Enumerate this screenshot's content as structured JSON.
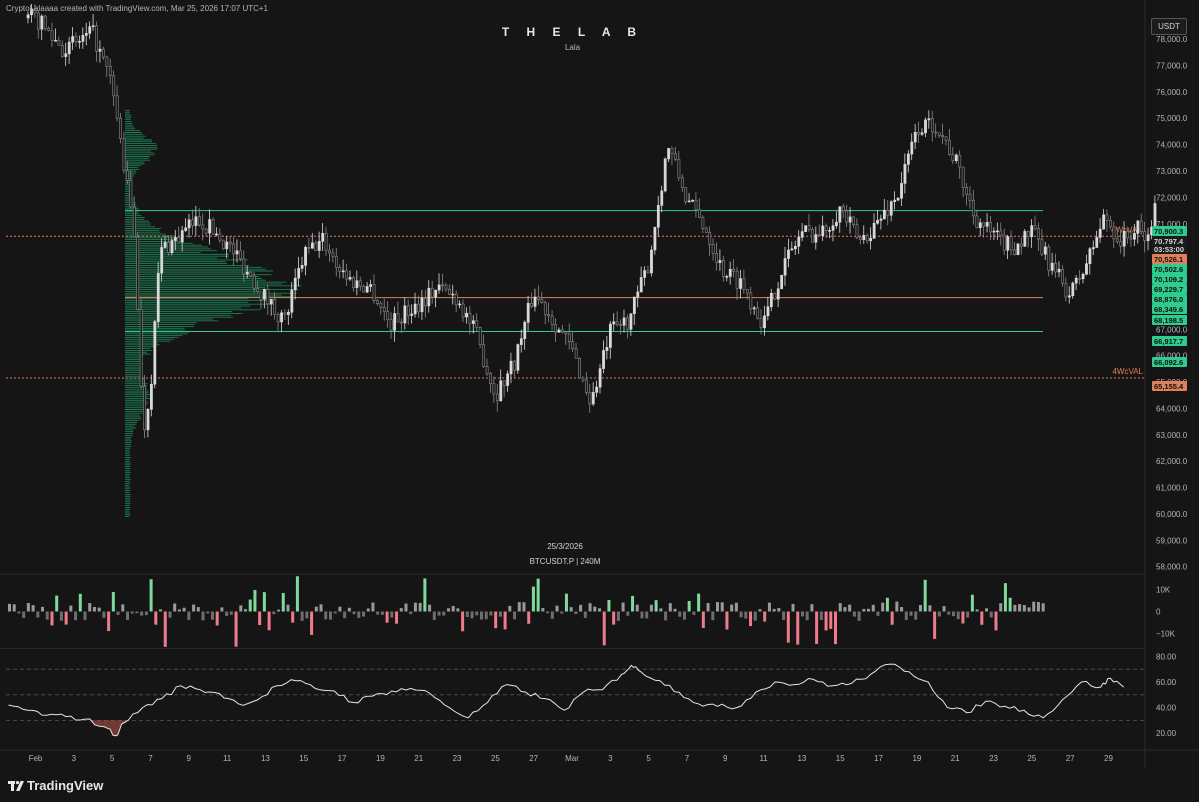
{
  "header": {
    "credit": "CryptoLalaaaa created with TradingView.com, Mar 25, 2026 17:07 UTC+1",
    "title": "T H E  L A B",
    "subtitle": "Lala",
    "currency_button": "USDT",
    "date_caption": "25/3/2026",
    "symbol_caption": "BTCUSDT.P | 240M",
    "brand": "TradingView"
  },
  "colors": {
    "background": "#151515",
    "green_level": "#2ecc8f",
    "orange_level": "#e0805a",
    "up_candle": "#d9d9d9",
    "volume_profile": "#1d8a5a",
    "delta_up": "#7ed99a",
    "delta_down": "#f07a8a"
  },
  "chart_data": [
    {
      "type": "candlestick",
      "title": "T H E  L A B",
      "symbol": "BTCUSDT.P",
      "timeframe": "240M",
      "y_ticks": [
        78000,
        77000,
        76000,
        75000,
        74000,
        73000,
        72000,
        71000,
        70000,
        69000,
        68000,
        67000,
        66000,
        65000,
        64000,
        63000,
        62000,
        61000,
        60000,
        59000,
        58000
      ],
      "y_tick_labels": [
        "78,000.0",
        "77,000.0",
        "76,000.0",
        "75,000.0",
        "74,000.0",
        "73,000.0",
        "72,000.0",
        "71,000.0",
        "70,000.0",
        "69,000.0",
        "68,000.0",
        "67,000.0",
        "66,000.0",
        "65,000.0",
        "64,000.0",
        "63,000.0",
        "62,000.0",
        "61,000.0",
        "60,000.0",
        "59,000.0",
        "58,000.0"
      ],
      "ylim": [
        57800,
        78800
      ],
      "x_tick_labels": [
        "Feb",
        "3",
        "5",
        "7",
        "9",
        "11",
        "13",
        "15",
        "17",
        "19",
        "21",
        "23",
        "25",
        "27",
        "Mar",
        "3",
        "5",
        "7",
        "9",
        "11",
        "13",
        "15",
        "17",
        "19",
        "21",
        "23",
        "25",
        "27",
        "29"
      ],
      "price_path": [
        [
          0,
          78800
        ],
        [
          1.5,
          77600
        ],
        [
          3,
          78200
        ],
        [
          4,
          76200
        ],
        [
          5.2,
          70400
        ],
        [
          5.6,
          63000
        ],
        [
          6,
          64800
        ],
        [
          6.5,
          70000
        ],
        [
          7.5,
          70500
        ],
        [
          8.5,
          71200
        ],
        [
          9.5,
          70600
        ],
        [
          10.5,
          69800
        ],
        [
          12,
          68200
        ],
        [
          13,
          67300
        ],
        [
          14,
          69800
        ],
        [
          15,
          70400
        ],
        [
          15.8,
          69400
        ],
        [
          16.5,
          68800
        ],
        [
          17.5,
          68600
        ],
        [
          18.5,
          67200
        ],
        [
          20,
          68000
        ],
        [
          21,
          68600
        ],
        [
          22,
          68200
        ],
        [
          23,
          66800
        ],
        [
          24,
          64500
        ],
        [
          25,
          65800
        ],
        [
          26,
          68400
        ],
        [
          27,
          67400
        ],
        [
          28,
          66200
        ],
        [
          29,
          64200
        ],
        [
          30,
          66900
        ],
        [
          31,
          67400
        ],
        [
          32,
          69500
        ],
        [
          33,
          74000
        ],
        [
          34,
          71900
        ],
        [
          35,
          70800
        ],
        [
          35.8,
          69300
        ],
        [
          36.8,
          68800
        ],
        [
          37.5,
          67900
        ],
        [
          38,
          67200
        ],
        [
          39,
          69400
        ],
        [
          40,
          70700
        ],
        [
          41,
          70600
        ],
        [
          42,
          71600
        ],
        [
          43,
          70300
        ],
        [
          44,
          71100
        ],
        [
          45,
          72100
        ],
        [
          46,
          74600
        ],
        [
          47,
          74800
        ],
        [
          48,
          73400
        ],
        [
          49,
          71300
        ],
        [
          50,
          70500
        ],
        [
          51,
          70100
        ],
        [
          52,
          70700
        ],
        [
          53,
          69400
        ],
        [
          54,
          68300
        ],
        [
          54.8,
          69400
        ],
        [
          55.8,
          71300
        ],
        [
          56.6,
          70300
        ],
        [
          57.5,
          70800
        ],
        [
          58,
          70300
        ],
        [
          58.4,
          71600
        ],
        [
          58.6,
          70500
        ]
      ],
      "levels": [
        {
          "label": "",
          "value": 71500,
          "color": "#2ecc8f",
          "style": "solid"
        },
        {
          "label": "4WcVAH",
          "value": 70526,
          "color": "#e0805a",
          "style": "dotted"
        },
        {
          "label": "",
          "value": 68198.5,
          "color": "#e0805a",
          "style": "solid"
        },
        {
          "label": "",
          "value": 66917.7,
          "color": "#2ecc8f",
          "style": "solid"
        },
        {
          "label": "4WcVAL",
          "value": 65155.4,
          "color": "#e0805a",
          "style": "dotted"
        }
      ],
      "price_tags": [
        {
          "text": "70,900.3",
          "color": "#2ecc8f"
        },
        {
          "text": "70,797.4",
          "color": "#1c1c1c"
        },
        {
          "text": "03:53:00",
          "color": "#1c1c1c"
        },
        {
          "text": "70,526.1",
          "color": "#e0805a"
        },
        {
          "text": "70,502.6",
          "color": "#2ecc8f"
        },
        {
          "text": "70,109.2",
          "color": "#2ecc8f"
        },
        {
          "text": "69,229.7",
          "color": "#2ecc8f"
        },
        {
          "text": "68,876.0",
          "color": "#2ecc8f"
        },
        {
          "text": "68,349.6",
          "color": "#2ecc8f"
        },
        {
          "text": "68,198.5",
          "color": "#2ecc8f"
        },
        {
          "text": "66,917.7",
          "color": "#2ecc8f"
        },
        {
          "text": "66,092.6",
          "color": "#2ecc8f"
        },
        {
          "text": "65,155.4",
          "color": "#e0805a"
        }
      ]
    },
    {
      "type": "bar",
      "name": "delta volume",
      "y_tick_labels": [
        "10K",
        "0",
        "−10K"
      ],
      "ylim": [
        -16000,
        16000
      ]
    },
    {
      "type": "line",
      "name": "oscillator",
      "y_tick_labels": [
        "80.00",
        "60.00",
        "40.00",
        "20.00"
      ],
      "ylim": [
        10,
        85
      ],
      "bands": [
        70,
        50,
        30
      ],
      "points": [
        [
          0,
          42
        ],
        [
          1,
          38
        ],
        [
          2,
          34
        ],
        [
          3,
          33
        ],
        [
          4,
          31
        ],
        [
          5,
          25
        ],
        [
          5.6,
          18
        ],
        [
          6,
          28
        ],
        [
          7,
          40
        ],
        [
          8,
          47
        ],
        [
          9,
          57
        ],
        [
          10,
          54
        ],
        [
          11,
          51
        ],
        [
          12,
          43
        ],
        [
          13,
          46
        ],
        [
          14,
          57
        ],
        [
          15,
          61
        ],
        [
          16,
          55
        ],
        [
          17,
          53
        ],
        [
          18,
          44
        ],
        [
          19,
          49
        ],
        [
          20,
          53
        ],
        [
          21,
          55
        ],
        [
          22,
          51
        ],
        [
          23,
          40
        ],
        [
          24,
          32
        ],
        [
          25,
          44
        ],
        [
          26,
          58
        ],
        [
          27,
          52
        ],
        [
          28,
          47
        ],
        [
          29,
          38
        ],
        [
          30,
          52
        ],
        [
          31,
          54
        ],
        [
          32,
          66
        ],
        [
          32.5,
          73
        ],
        [
          33,
          68
        ],
        [
          34,
          61
        ],
        [
          35,
          52
        ],
        [
          36,
          43
        ],
        [
          37,
          41
        ],
        [
          38,
          40
        ],
        [
          39,
          52
        ],
        [
          40,
          60
        ],
        [
          41,
          58
        ],
        [
          42,
          62
        ],
        [
          43,
          57
        ],
        [
          44,
          59
        ],
        [
          45,
          66
        ],
        [
          46,
          74
        ],
        [
          47,
          68
        ],
        [
          48,
          60
        ],
        [
          49,
          40
        ],
        [
          50,
          36
        ],
        [
          51,
          45
        ],
        [
          52,
          41
        ],
        [
          53,
          38
        ],
        [
          54,
          32
        ],
        [
          55,
          46
        ],
        [
          56,
          60
        ],
        [
          57,
          56
        ],
        [
          57.5,
          63
        ],
        [
          58.2,
          56
        ]
      ]
    }
  ]
}
